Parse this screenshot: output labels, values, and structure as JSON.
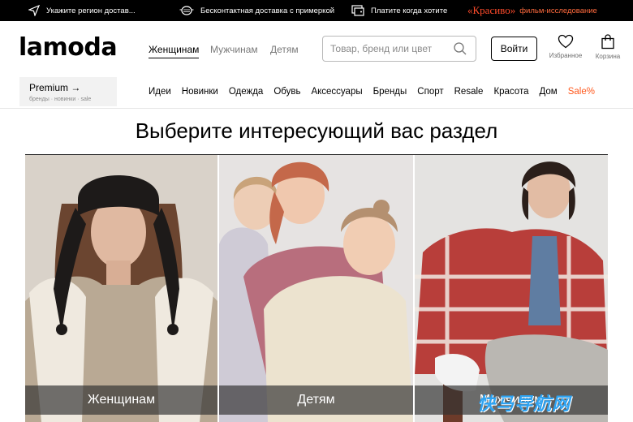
{
  "topbar": {
    "region": "Укажите регион достав...",
    "delivery": "Бесконтактная доставка с примеркой",
    "payment": "Платите когда хотите",
    "promo_logo": "«Красиво»",
    "promo_text": "фильм-исследование"
  },
  "header": {
    "logo": "lamoda",
    "tabs": [
      {
        "label": "Женщинам",
        "active": true
      },
      {
        "label": "Мужчинам",
        "active": false
      },
      {
        "label": "Детям",
        "active": false
      }
    ],
    "search_placeholder": "Товар, бренд или цвет",
    "login": "Войти",
    "favorites": "Избранное",
    "cart": "Корзина"
  },
  "premium": {
    "title": "Premium →",
    "subtitle": "бренды · новинки · sale"
  },
  "categories": [
    "Идеи",
    "Новинки",
    "Одежда",
    "Обувь",
    "Аксессуары",
    "Бренды",
    "Спорт",
    "Resale",
    "Красота",
    "Дом",
    "Sale%"
  ],
  "main": {
    "title": "Выберите интересующий вас раздел",
    "sections": [
      {
        "label": "Женщинам"
      },
      {
        "label": "Детям"
      },
      {
        "label": "Мужчинам"
      }
    ]
  },
  "watermark": "快马导航网",
  "colors": {
    "accent_sale": "#ff5a1f",
    "promo": "#ff4b2b",
    "topbar_bg": "#000000",
    "watermark": "#2ea3f2"
  }
}
